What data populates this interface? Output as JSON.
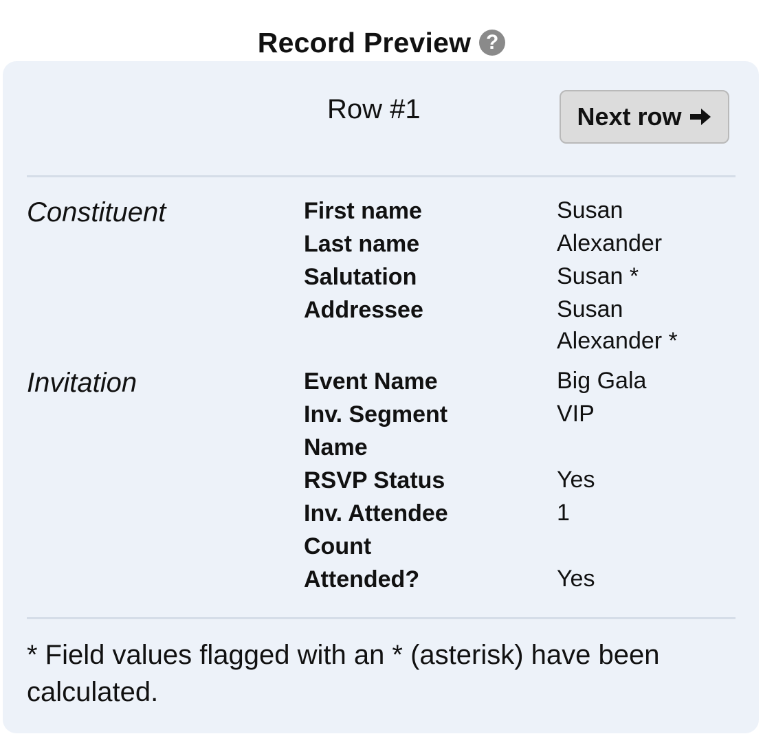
{
  "header": {
    "title": "Record Preview",
    "help_icon": "question-circle-icon"
  },
  "navigation": {
    "row_label": "Row #1",
    "next_button_label": "Next row",
    "next_button_icon": "arrow-right-icon"
  },
  "sections": [
    {
      "name": "Constituent",
      "fields": [
        {
          "label": "First name",
          "value": "Susan"
        },
        {
          "label": "Last name",
          "value": "Alexander"
        },
        {
          "label": "Salutation",
          "value": "Susan *"
        },
        {
          "label": "Addressee",
          "value": "Susan Alexander *"
        }
      ]
    },
    {
      "name": "Invitation",
      "fields": [
        {
          "label": "Event Name",
          "value": "Big Gala"
        },
        {
          "label": "Inv. Segment Name",
          "value": "VIP"
        },
        {
          "label": "RSVP Status",
          "value": "Yes"
        },
        {
          "label": "Inv. Attendee Count",
          "value": "1"
        },
        {
          "label": "Attended?",
          "value": "Yes"
        }
      ]
    }
  ],
  "footnote": "* Field values flagged with an * (asterisk) have been calculated.",
  "colors": {
    "panel_background": "#edf2f9",
    "divider": "#d5dde8",
    "button_background": "#dcdcdc",
    "button_border": "#b9b9b9",
    "help_icon": "#8a8a8a"
  }
}
